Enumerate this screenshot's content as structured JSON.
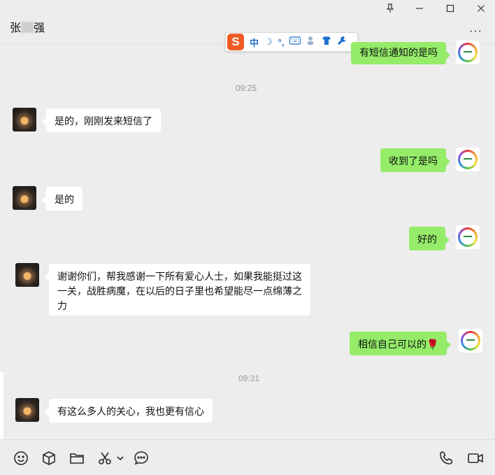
{
  "window": {
    "title_prefix": "张",
    "title_suffix": "强",
    "pin_icon": "pin-icon",
    "minimize_icon": "minimize-icon",
    "maximize_icon": "maximize-icon",
    "close_icon": "close-icon",
    "more_label": "···"
  },
  "ime_toolbar": {
    "logo": "S",
    "mode": "中",
    "moon": "☽",
    "punct": "°,",
    "icons": [
      "keyboard-icon",
      "person-icon",
      "shirt-icon",
      "wrench-icon"
    ]
  },
  "messages": [
    {
      "side": "out",
      "text": "有短信通知的是吗"
    },
    {
      "side": "time",
      "text": "09:25"
    },
    {
      "side": "in",
      "text": "是的，刚刚发来短信了"
    },
    {
      "side": "out",
      "text": "收到了是吗"
    },
    {
      "side": "in",
      "text": "是的"
    },
    {
      "side": "out",
      "text": "好的"
    },
    {
      "side": "in",
      "text": "谢谢你们，帮我感谢一下所有爱心人士，如果我能挺过这一关，战胜病魔，在以后的日子里也希望能尽一点绵薄之力"
    },
    {
      "side": "out",
      "text": "相信自己可以的",
      "emoji": "🌹"
    },
    {
      "side": "time",
      "text": "09:31"
    },
    {
      "side": "in",
      "text": "有这么多人的关心，我也更有信心"
    }
  ],
  "toolbar": {
    "icons": [
      "emoji-icon",
      "box-icon",
      "folder-icon",
      "scissors-icon",
      "chevron-down-icon",
      "chat-history-icon",
      "phone-icon",
      "video-icon"
    ]
  },
  "colors": {
    "background": "#ededed",
    "outgoing_bubble": "#95ec69",
    "incoming_bubble": "#ffffff",
    "timestamp": "#9a9a9a"
  }
}
